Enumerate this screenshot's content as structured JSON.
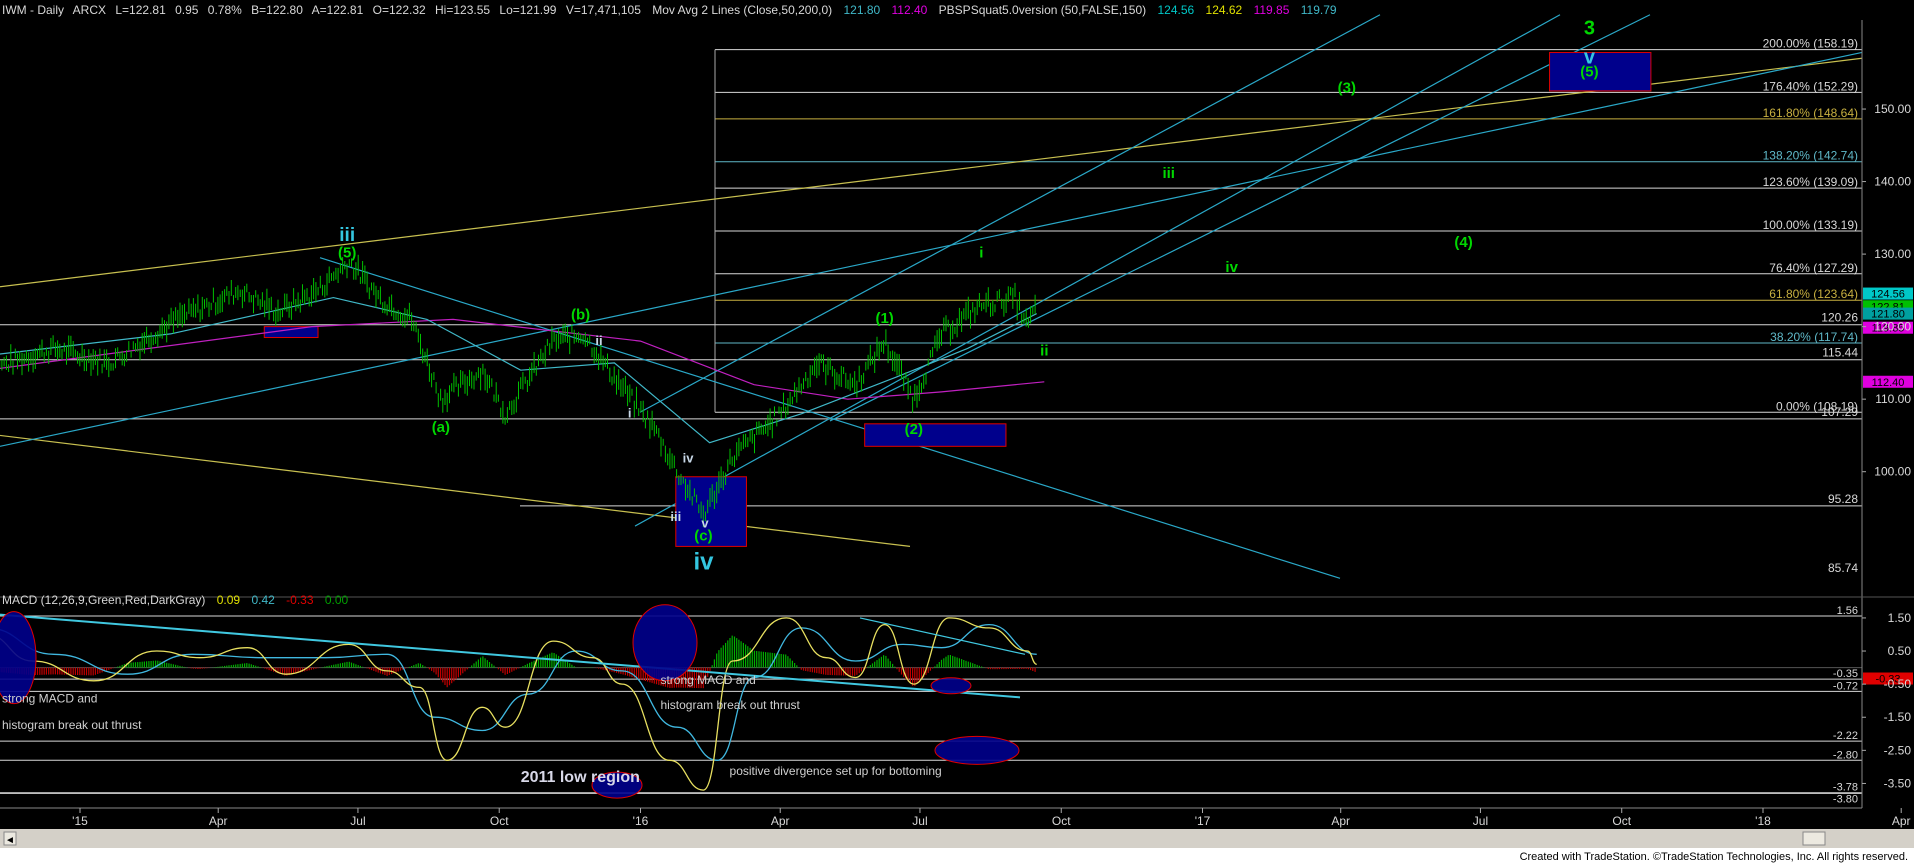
{
  "header": {
    "symbol": "IWM - Daily",
    "exchange": "ARCX",
    "last": "L=122.81",
    "change": "0.95",
    "change_pct": "0.78%",
    "bid": "B=122.80",
    "ask": "A=122.81",
    "open": "O=122.32",
    "high": "Hi=123.55",
    "low": "Lo=121.99",
    "volume": "V=17,471,105",
    "mav_name": "Mov Avg 2 Lines (Close,50,200,0)",
    "mav_50": "121.80",
    "mav_200": "112.40",
    "pbs_name": "PBSPSquat5.0version (50,FALSE,150)",
    "pbs_1": "124.56",
    "pbs_2": "124.62",
    "pbs_3": "119.85",
    "pbs_4": "119.79"
  },
  "colors": {
    "background": "#000000",
    "price_bars": "#00c000",
    "wave_green": "#00d800",
    "wave_blue": "#34c6e0",
    "trendline_cyan": "#2aa8c8",
    "trendline_yellow": "#c8c050",
    "fib_white": "#d8d8d8",
    "fib_gold": "#c8b040",
    "fib_teal": "#5fb8c8",
    "ma_cyan": "#40b8c8",
    "ma_magenta": "#c020c0",
    "box_fill": "#00008c",
    "box_border": "#e00000"
  },
  "chart_data": [
    {
      "type": "candlestick",
      "title": "IWM - Daily",
      "x_ticks": [
        "'15",
        "Apr",
        "Jul",
        "Oct",
        "'16",
        "Apr",
        "Jul",
        "Oct",
        "'17",
        "Apr",
        "Jul",
        "Oct",
        "'18",
        "Apr"
      ],
      "y_ticks": [
        100.0,
        110.0,
        120.0,
        130.0,
        140.0,
        150.0
      ],
      "ylim": [
        83,
        162
      ],
      "close_path": [
        [
          "2014-11-01",
          114
        ],
        [
          "2014-12-15",
          117
        ],
        [
          "2015-01-20",
          115
        ],
        [
          "2015-03-05",
          121
        ],
        [
          "2015-04-15",
          125
        ],
        [
          "2015-05-10",
          122
        ],
        [
          "2015-06-05",
          125
        ],
        [
          "2015-06-25",
          129
        ],
        [
          "2015-07-15",
          124
        ],
        [
          "2015-08-05",
          121
        ],
        [
          "2015-08-24",
          110
        ],
        [
          "2015-09-20",
          114
        ],
        [
          "2015-10-05",
          108
        ],
        [
          "2015-11-05",
          118
        ],
        [
          "2015-11-25",
          119
        ],
        [
          "2015-12-15",
          113
        ],
        [
          "2016-01-10",
          106
        ],
        [
          "2016-01-25",
          100
        ],
        [
          "2016-02-11",
          94
        ],
        [
          "2016-03-01",
          102
        ],
        [
          "2016-04-01",
          108
        ],
        [
          "2016-04-25",
          115
        ],
        [
          "2016-05-20",
          112
        ],
        [
          "2016-06-08",
          118
        ],
        [
          "2016-06-27",
          110
        ],
        [
          "2016-07-15",
          119
        ],
        [
          "2016-08-10",
          123
        ],
        [
          "2016-09-01",
          124
        ],
        [
          "2016-09-09",
          120
        ],
        [
          "2016-09-15",
          123
        ]
      ],
      "ma_50_path": [
        [
          "2014-11-01",
          116
        ],
        [
          "2015-03-01",
          119
        ],
        [
          "2015-06-15",
          124
        ],
        [
          "2015-08-15",
          121
        ],
        [
          "2015-10-15",
          114
        ],
        [
          "2015-12-15",
          115
        ],
        [
          "2016-02-15",
          104
        ],
        [
          "2016-04-15",
          108
        ],
        [
          "2016-06-15",
          113
        ],
        [
          "2016-08-01",
          117
        ],
        [
          "2016-09-15",
          121.8
        ]
      ],
      "ma_200_path": [
        [
          "2014-11-01",
          114
        ],
        [
          "2015-06-01",
          120
        ],
        [
          "2015-09-01",
          121
        ],
        [
          "2016-01-01",
          118
        ],
        [
          "2016-03-15",
          112
        ],
        [
          "2016-05-15",
          110
        ],
        [
          "2016-07-15",
          111
        ],
        [
          "2016-09-20",
          112.4
        ]
      ],
      "fib_levels": [
        {
          "label": "200.00% (158.19)",
          "value": 158.19,
          "color": "fib_white"
        },
        {
          "label": "176.40% (152.29)",
          "value": 152.29,
          "color": "fib_white"
        },
        {
          "label": "161.80% (148.64)",
          "value": 148.64,
          "color": "fib_gold"
        },
        {
          "label": "138.20% (142.74)",
          "value": 142.74,
          "color": "fib_teal"
        },
        {
          "label": "123.60% (139.09)",
          "value": 139.09,
          "color": "fib_white"
        },
        {
          "label": "100.00% (133.19)",
          "value": 133.19,
          "color": "fib_white"
        },
        {
          "label": "76.40% (127.29)",
          "value": 127.29,
          "color": "fib_white"
        },
        {
          "label": "61.80% (123.64)",
          "value": 123.64,
          "color": "fib_gold"
        },
        {
          "label": "38.20% (117.74)",
          "value": 117.74,
          "color": "fib_teal"
        },
        {
          "label": "0.00% (108.19)",
          "value": 108.19,
          "color": "fib_white"
        }
      ],
      "horizontal_levels": [
        {
          "label": "120.26",
          "value": 120.26
        },
        {
          "label": "115.44",
          "value": 115.44
        },
        {
          "label": "107.29",
          "value": 107.29
        },
        {
          "label": "95.28",
          "value": 95.28
        },
        {
          "label": "85.74",
          "value": 85.74
        }
      ],
      "right_price_tags": [
        {
          "label": "124.56",
          "value": 124.56,
          "color": "#00c8c8"
        },
        {
          "label": "122.81",
          "value": 122.81,
          "color": "#00c000"
        },
        {
          "label": "121.80",
          "value": 121.8,
          "color": "#00a0a0"
        },
        {
          "label": "119.85",
          "value": 119.85,
          "color": "#e000e0"
        },
        {
          "label": "112.40",
          "value": 112.4,
          "color": "#e000e0"
        }
      ],
      "wave_labels_green": [
        {
          "text": "(5)",
          "date": "2015-06-24",
          "value": 129.5
        },
        {
          "text": "(a)",
          "date": "2015-08-24",
          "value": 105.5
        },
        {
          "text": "(b)",
          "date": "2015-11-23",
          "value": 121
        },
        {
          "text": "(c)",
          "date": "2016-02-11",
          "value": 90.5
        },
        {
          "text": "(1)",
          "date": "2016-06-08",
          "value": 120.5
        },
        {
          "text": "(2)",
          "date": "2016-06-27",
          "value": 105.2
        },
        {
          "text": "i",
          "date": "2016-08-10",
          "value": 129.5
        },
        {
          "text": "ii",
          "date": "2016-09-20",
          "value": 116
        },
        {
          "text": "iii",
          "date": "2016-12-10",
          "value": 140.5
        },
        {
          "text": "iv",
          "date": "2017-01-20",
          "value": 127.5
        },
        {
          "text": "(3)",
          "date": "2017-04-05",
          "value": 152.3
        },
        {
          "text": "(4)",
          "date": "2017-06-20",
          "value": 131
        },
        {
          "text": "(5)",
          "date": "2017-09-10",
          "value": 154.5
        }
      ],
      "wave_labels_blue": [
        {
          "text": "iii",
          "date": "2015-06-24",
          "value": 131.8,
          "size": 19
        },
        {
          "text": "iv",
          "date": "2016-02-11",
          "value": 86.5,
          "size": 24
        },
        {
          "text": "v",
          "date": "2017-09-10",
          "value": 156.3,
          "size": 20
        },
        {
          "text": "3",
          "date": "2017-09-10",
          "value": 160.3,
          "size": 20
        }
      ],
      "wave_labels_white": [
        {
          "text": "ii",
          "date": "2015-12-05",
          "value": 117.5
        },
        {
          "text": "i",
          "date": "2015-12-25",
          "value": 107.5
        },
        {
          "text": "iv",
          "date": "2016-02-01",
          "value": 101.3
        },
        {
          "text": "iii",
          "date": "2016-01-24",
          "value": 93.2
        },
        {
          "text": "v",
          "date": "2016-02-12",
          "value": 92.3
        }
      ],
      "boxes": [
        {
          "from": "2015-05-01",
          "to": "2015-06-05",
          "top": 120,
          "bottom": 118.5
        },
        {
          "from": "2016-01-24",
          "to": "2016-03-10",
          "top": 99.3,
          "bottom": 89.7
        },
        {
          "from": "2016-05-26",
          "to": "2016-08-26",
          "top": 106.6,
          "bottom": 103.5
        },
        {
          "from": "2017-08-15",
          "to": "2017-10-20",
          "top": 157.8,
          "bottom": 152.5
        }
      ]
    },
    {
      "type": "macd",
      "label": "MACD (12,26,9,Green,Red,DarkGray)",
      "values": [
        "0.09",
        "0.42",
        "-0.33",
        "0.00"
      ],
      "y_ticks": [
        1.5,
        0.5,
        -0.5,
        -1.5,
        -2.5,
        -3.5
      ],
      "ylim": [
        -4.0,
        1.8
      ],
      "levels": [
        {
          "label": "1.56",
          "value": 1.56
        },
        {
          "label": "-0.35",
          "value": -0.35
        },
        {
          "label": "-0.72",
          "value": -0.72
        },
        {
          "label": "-2.22",
          "value": -2.22
        },
        {
          "label": "-2.80",
          "value": -2.8
        },
        {
          "label": "-3.78",
          "value": -3.78
        },
        {
          "label": "-3.80",
          "value": -3.8
        }
      ],
      "current_tag": {
        "label": "-0.33",
        "value": -0.33
      },
      "macd_path": [
        [
          "2014-11-01",
          1.0
        ],
        [
          "2014-12-01",
          0.2
        ],
        [
          "2015-01-10",
          -0.4
        ],
        [
          "2015-02-20",
          0.5
        ],
        [
          "2015-03-20",
          0.3
        ],
        [
          "2015-04-20",
          0.6
        ],
        [
          "2015-05-15",
          -0.2
        ],
        [
          "2015-06-25",
          0.7
        ],
        [
          "2015-07-20",
          -0.1
        ],
        [
          "2015-08-10",
          -0.6
        ],
        [
          "2015-08-28",
          -2.8
        ],
        [
          "2015-09-20",
          -1.2
        ],
        [
          "2015-10-05",
          -1.8
        ],
        [
          "2015-11-05",
          0.8
        ],
        [
          "2015-12-01",
          0.3
        ],
        [
          "2015-12-20",
          -0.5
        ],
        [
          "2016-01-20",
          -2.8
        ],
        [
          "2016-02-11",
          -3.7
        ],
        [
          "2016-03-01",
          0.2
        ],
        [
          "2016-04-05",
          1.5
        ],
        [
          "2016-05-01",
          0.3
        ],
        [
          "2016-05-20",
          -0.3
        ],
        [
          "2016-06-08",
          1.3
        ],
        [
          "2016-06-27",
          -0.5
        ],
        [
          "2016-07-20",
          1.5
        ],
        [
          "2016-08-15",
          1.2
        ],
        [
          "2016-09-09",
          0.5
        ],
        [
          "2016-09-15",
          0.1
        ]
      ],
      "signal_path": [
        [
          "2014-11-01",
          1.2
        ],
        [
          "2014-12-15",
          0.4
        ],
        [
          "2015-02-01",
          -0.2
        ],
        [
          "2015-03-15",
          0.4
        ],
        [
          "2015-05-01",
          0.3
        ],
        [
          "2015-06-10",
          0.3
        ],
        [
          "2015-07-20",
          0.4
        ],
        [
          "2015-08-20",
          -1.5
        ],
        [
          "2015-09-20",
          -1.9
        ],
        [
          "2015-10-20",
          -0.8
        ],
        [
          "2015-11-20",
          0.5
        ],
        [
          "2015-12-20",
          -0.1
        ],
        [
          "2016-01-25",
          -1.8
        ],
        [
          "2016-02-20",
          -2.8
        ],
        [
          "2016-03-15",
          -0.3
        ],
        [
          "2016-04-15",
          1.2
        ],
        [
          "2016-05-20",
          0.2
        ],
        [
          "2016-06-20",
          0.7
        ],
        [
          "2016-07-15",
          0.6
        ],
        [
          "2016-08-15",
          1.3
        ],
        [
          "2016-09-15",
          0.4
        ]
      ],
      "annotations": [
        {
          "text": "strong MACD and",
          "date": "2014-11-01",
          "value": -1.05
        },
        {
          "text": "histogram break out thrust",
          "date": "2014-11-01",
          "value": -1.85
        },
        {
          "text": "strong MACD  and",
          "date": "2016-01-14",
          "value": -0.5
        },
        {
          "text": "histogram break out thrust",
          "date": "2016-01-14",
          "value": -1.25
        },
        {
          "text": "positive divergence set up for bottoming",
          "date": "2016-02-28",
          "value": -3.25
        }
      ],
      "region_label": {
        "text": "2011 low region",
        "date": "2015-10-15",
        "value": -3.45
      }
    }
  ],
  "footer": {
    "credit": "Created with TradeStation. ©TradeStation Technologies, Inc. All rights reserved."
  }
}
